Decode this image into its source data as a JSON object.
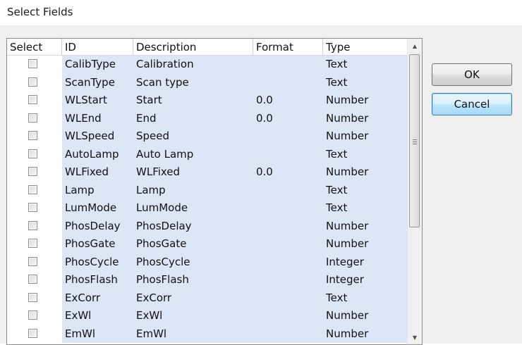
{
  "window": {
    "title": "Select Fields"
  },
  "table": {
    "columns": [
      "Select",
      "ID",
      "Description",
      "Format",
      "Type"
    ],
    "rows": [
      {
        "checked": false,
        "id": "CalibType",
        "description": "Calibration",
        "format": "",
        "type": "Text"
      },
      {
        "checked": false,
        "id": "ScanType",
        "description": "Scan type",
        "format": "",
        "type": "Text"
      },
      {
        "checked": false,
        "id": "WLStart",
        "description": "Start",
        "format": "0.0",
        "type": "Number"
      },
      {
        "checked": false,
        "id": "WLEnd",
        "description": "End",
        "format": "0.0",
        "type": "Number"
      },
      {
        "checked": false,
        "id": "WLSpeed",
        "description": "Speed",
        "format": "",
        "type": "Number"
      },
      {
        "checked": false,
        "id": "AutoLamp",
        "description": "Auto Lamp",
        "format": "",
        "type": "Text"
      },
      {
        "checked": false,
        "id": "WLFixed",
        "description": "WLFixed",
        "format": "0.0",
        "type": "Number"
      },
      {
        "checked": false,
        "id": "Lamp",
        "description": "Lamp",
        "format": "",
        "type": "Text"
      },
      {
        "checked": false,
        "id": "LumMode",
        "description": "LumMode",
        "format": "",
        "type": "Text"
      },
      {
        "checked": false,
        "id": "PhosDelay",
        "description": "PhosDelay",
        "format": "",
        "type": "Number"
      },
      {
        "checked": false,
        "id": "PhosGate",
        "description": "PhosGate",
        "format": "",
        "type": "Number"
      },
      {
        "checked": false,
        "id": "PhosCycle",
        "description": "PhosCycle",
        "format": "",
        "type": "Integer"
      },
      {
        "checked": false,
        "id": "PhosFlash",
        "description": "PhosFlash",
        "format": "",
        "type": "Integer"
      },
      {
        "checked": false,
        "id": "ExCorr",
        "description": "ExCorr",
        "format": "",
        "type": "Text"
      },
      {
        "checked": false,
        "id": "ExWl",
        "description": "ExWl",
        "format": "",
        "type": "Number"
      },
      {
        "checked": false,
        "id": "EmWl",
        "description": "EmWl",
        "format": "",
        "type": "Number"
      }
    ],
    "scrollbar": {
      "up_icon": "scroll-up-arrow-icon",
      "down_icon": "scroll-down-arrow-icon",
      "grip_icon": "scroll-grip-icon",
      "thumb_position": 0.0
    }
  },
  "buttons": {
    "ok_label": "OK",
    "cancel_label": "Cancel"
  }
}
